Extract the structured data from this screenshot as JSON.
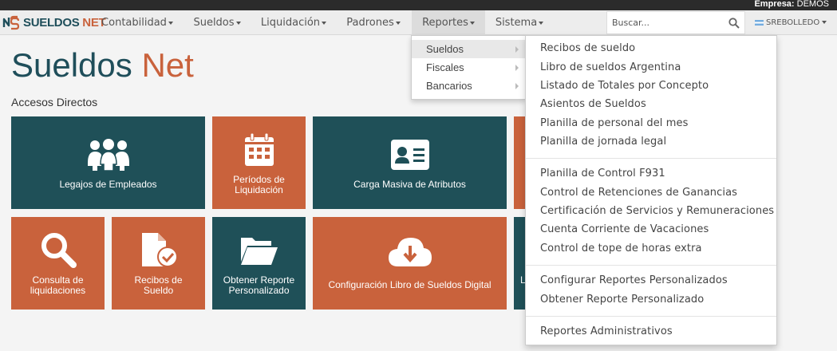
{
  "topbar": {
    "company_label": "Empresa:",
    "company_name": "DEMOS"
  },
  "logo": {
    "word1": "SUELDOS",
    "word2": "NET"
  },
  "nav": {
    "items": [
      {
        "label": "Contabilidad"
      },
      {
        "label": "Sueldos"
      },
      {
        "label": "Liquidación"
      },
      {
        "label": "Padrones"
      },
      {
        "label": "Reportes"
      },
      {
        "label": "Sistema"
      }
    ],
    "search_placeholder": "Buscar...",
    "user": "SREBOLLEDO"
  },
  "page": {
    "title_part1": "Sueldos",
    "title_part2": "Net",
    "section": "Accesos Directos"
  },
  "tiles": [
    {
      "label_l1": "Legajos de Empleados",
      "label_l2": "",
      "color": "#1f5058",
      "icon": "users-icon"
    },
    {
      "label_l1": "Períodos de",
      "label_l2": "Liquidación",
      "color": "#c9623c",
      "icon": "calendar-icon"
    },
    {
      "label_l1": "Carga Masiva de Atributos",
      "label_l2": "",
      "color": "#1f5058",
      "icon": "id-card-icon"
    },
    {
      "label_l1": "Consulta de",
      "label_l2": "liquidaciones",
      "color": "#c9623c",
      "icon": "search-icon"
    },
    {
      "label_l1": "Recibos de",
      "label_l2": "Sueldo",
      "color": "#c9623c",
      "icon": "file-check-icon"
    },
    {
      "label_l1": "Obtener Reporte",
      "label_l2": "Personalizado",
      "color": "#1f5058",
      "icon": "folder-open-icon"
    },
    {
      "label_l1": "Configuración Libro de Sueldos Digital",
      "label_l2": "",
      "color": "#c9623c",
      "icon": "cloud-download-icon"
    }
  ],
  "partial_tile_text": "Li",
  "submenu": {
    "items": [
      {
        "label": "Sueldos"
      },
      {
        "label": "Fiscales"
      },
      {
        "label": "Bancarios"
      }
    ]
  },
  "dropdown": {
    "groups": [
      [
        "Recibos de sueldo",
        "Libro de sueldos Argentina",
        "Listado de Totales por Concepto",
        "Asientos de Sueldos",
        "Planilla de personal del mes",
        "Planilla de jornada legal"
      ],
      [
        "Planilla de Control F931",
        "Control de Retenciones de Ganancias",
        "Certificación de Servicios y Remuneraciones",
        "Cuenta Corriente de Vacaciones",
        "Control de tope de horas extra"
      ],
      [
        "Configurar Reportes Personalizados",
        "Obtener Reporte Personalizado"
      ],
      [
        "Reportes Administrativos"
      ]
    ]
  },
  "colors": {
    "teal": "#1f5058",
    "orange": "#c9623c",
    "topbar": "#2b2b2b",
    "navbar": "#ededed"
  }
}
